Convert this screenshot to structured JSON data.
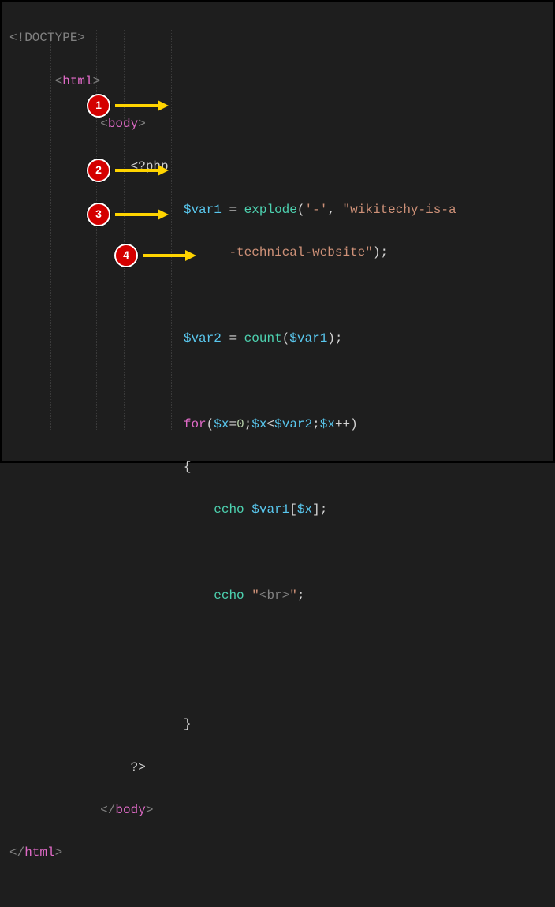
{
  "code": {
    "doctype": "<!DOCTYPE>",
    "html_open_l": "<",
    "html_open_name": "html",
    "html_open_r": ">",
    "body_open_l": "<",
    "body_open_name": "body",
    "body_open_r": ">",
    "php_open": "<?php",
    "var1": "$var1",
    "eq": " = ",
    "explode": "explode",
    "lpar": "(",
    "dash_str": "'-'",
    "comma": ", ",
    "wiki_str1": "\"wikitechy-is-a",
    "wiki_str2": "-technical-website\"",
    "rpar_semi": ");",
    "var2": "$var2",
    "count": "count",
    "count_arg_l": "(",
    "count_arg_var": "$var1",
    "count_arg_r": ");",
    "for_kw": "for",
    "for_l": "(",
    "x": "$x",
    "assign0": "=",
    "zero": "0",
    "semi": ";",
    "lt": "<",
    "for_var2": "$var2",
    "pp": "++",
    "for_r": ")",
    "brace_l": "{",
    "echo_kw": "echo",
    "sp": " ",
    "var1b": "$var1",
    "lbrack": "[",
    "xb": "$x",
    "rbrack_semi": "];",
    "echo_br_q1": "\"",
    "echo_br_tag": "<br>",
    "echo_br_q2": "\"",
    "stmt_semi": ";",
    "brace_r": "}",
    "php_close": "?>",
    "body_close_l": "</",
    "body_close_name": "body",
    "body_close_r": ">",
    "html_close_l": "</",
    "html_close_name": "html",
    "html_close_r": ">"
  },
  "annotations": {
    "b1": "1",
    "b2": "2",
    "b3": "3",
    "b4": "4"
  }
}
